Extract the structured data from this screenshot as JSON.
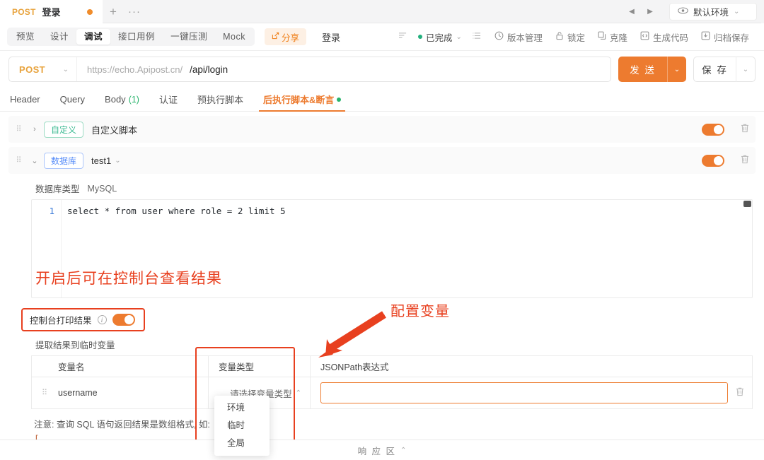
{
  "tabbar": {
    "method": "POST",
    "title": "登录",
    "add_label": "+",
    "more_label": "···",
    "prev_icon": "◀",
    "next_icon": "▶",
    "env_label": "默认环境",
    "env_icon": "eye-icon",
    "chevron": "⌄"
  },
  "secondbar": {
    "tabs": [
      {
        "label": "预览",
        "active": false
      },
      {
        "label": "设计",
        "active": false
      },
      {
        "label": "调试",
        "active": true
      },
      {
        "label": "接口用例",
        "active": false
      },
      {
        "label": "一键压测",
        "active": false
      },
      {
        "label": "Mock",
        "active": false
      }
    ],
    "share_label": "分享",
    "share_icon": "share-icon",
    "request_name": "登录",
    "sort_icon": "sort-icon",
    "status_label": "已完成",
    "status_color": "#22b07d",
    "list_icon": "list-icon",
    "actions": [
      {
        "label": "版本管理",
        "icon": "clock-icon"
      },
      {
        "label": "锁定",
        "icon": "lock-icon"
      },
      {
        "label": "克隆",
        "icon": "copy-icon"
      },
      {
        "label": "生成代码",
        "icon": "code-icon"
      },
      {
        "label": "归档保存",
        "icon": "archive-icon"
      }
    ]
  },
  "urlbar": {
    "method": "POST",
    "host": "https://echo.Apipost.cn/",
    "path": "/api/login",
    "send_label": "发 送",
    "save_label": "保 存",
    "chevron": "⌄"
  },
  "subtabs": [
    {
      "label": "Header",
      "count": "",
      "active": false,
      "dot": false
    },
    {
      "label": "Query",
      "count": "",
      "active": false,
      "dot": false
    },
    {
      "label": "Body",
      "count": "(1)",
      "active": false,
      "dot": false
    },
    {
      "label": "认证",
      "count": "",
      "active": false,
      "dot": false
    },
    {
      "label": "预执行脚本",
      "count": "",
      "active": false,
      "dot": false
    },
    {
      "label": "后执行脚本&断言",
      "count": "",
      "active": true,
      "dot": true
    }
  ],
  "script_rows": [
    {
      "badge": "自定义",
      "badge_color": "green",
      "label": "自定义脚本",
      "expanded": false,
      "toggle_on": true
    },
    {
      "badge": "数据库",
      "badge_color": "blue",
      "label": "test1",
      "expanded": true,
      "toggle_on": true
    }
  ],
  "database": {
    "type_label": "数据库类型",
    "type_value": "MySQL",
    "line_number": "1",
    "sql": "select * from user where role = 2 limit 5"
  },
  "console": {
    "label": "控制台打印结果",
    "info_icon": "info-icon",
    "toggle_on": true
  },
  "extract": {
    "section_label": "提取结果到临时变量",
    "headers": [
      "",
      "变量名",
      "变量类型",
      "JSONPath表达式"
    ],
    "rows": [
      {
        "name": "username",
        "type_placeholder": "请选择变量类型",
        "jsonpath": ""
      }
    ]
  },
  "type_dropdown": {
    "options": [
      "环境",
      "临时",
      "全局"
    ]
  },
  "note": {
    "text": "注意: 查询 SQL 语句返回结果是数组格式, 如:",
    "json_line1": "[",
    "json_line2": "  {"
  },
  "annotations": [
    {
      "text": "开启后可在控制台查看结果",
      "color": "#e8401f"
    },
    {
      "text": "配置变量",
      "color": "#e8401f"
    }
  ],
  "bottombar": {
    "label": "响 应 区",
    "chevron": "⌃"
  }
}
